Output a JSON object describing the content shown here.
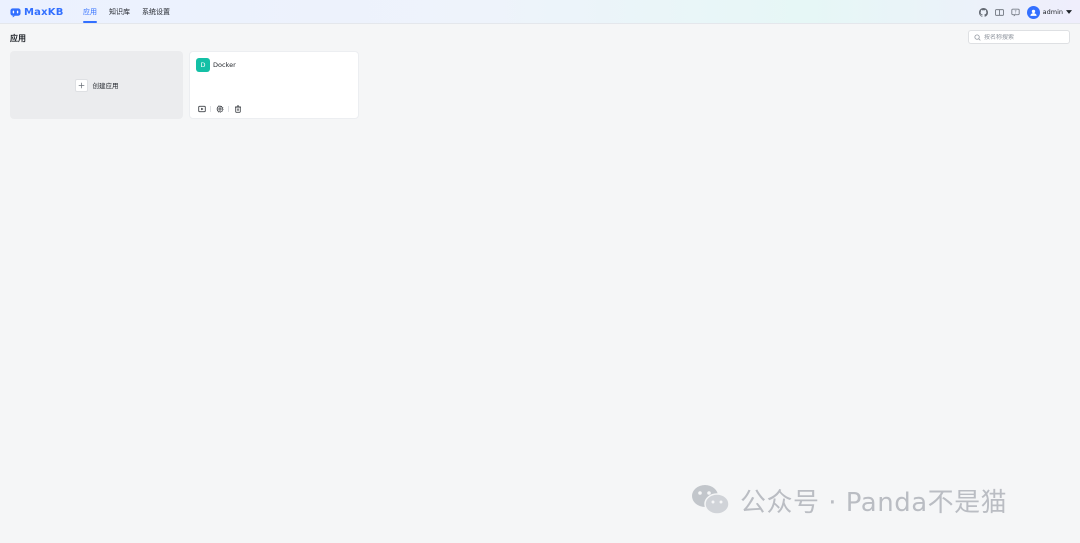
{
  "header": {
    "brand": "MaxKB",
    "nav": [
      {
        "label": "应用",
        "active": true
      },
      {
        "label": "知识库",
        "active": false
      },
      {
        "label": "系统设置",
        "active": false
      }
    ],
    "user": {
      "name": "admin"
    },
    "icons": [
      "github-icon",
      "book-icon",
      "help-icon",
      "avatar-icon",
      "caret-down-icon"
    ]
  },
  "main": {
    "title": "应用",
    "search": {
      "placeholder": "按名称搜索",
      "value": ""
    },
    "create_card": {
      "label": "创建应用"
    },
    "apps": [
      {
        "avatar_letter": "D",
        "name": "Docker",
        "avatar_color": "#14c0a6"
      }
    ]
  },
  "watermark": {
    "text": "公众号 · Panda不是猫"
  },
  "colors": {
    "accent": "#3370ff",
    "background": "#f5f6f7"
  }
}
